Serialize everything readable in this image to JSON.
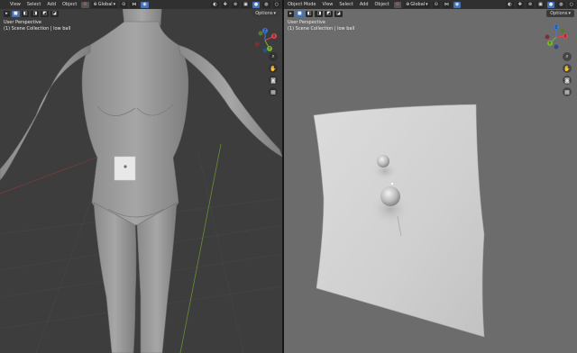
{
  "left_viewport": {
    "header": {
      "mode": "",
      "menus": [
        "View",
        "Select",
        "Add",
        "Object"
      ],
      "transform_orientation": "Global",
      "options_label": "Options"
    },
    "info": {
      "perspective": "User Perspective",
      "collection": "(1) Scene Collection | low ball"
    },
    "gizmo": {
      "x": "X",
      "y": "Y",
      "z": "Z"
    }
  },
  "right_viewport": {
    "header": {
      "mode": "Object Mode",
      "menus": [
        "View",
        "Select",
        "Add",
        "Object"
      ],
      "transform_orientation": "Global",
      "options_label": "Options"
    },
    "info": {
      "perspective": "User Perspective",
      "collection": "(1) Scene Collection | low ball"
    },
    "gizmo": {
      "x": "X",
      "y": "Y",
      "z": "Z"
    }
  },
  "colors": {
    "viewport_left_bg": "#3d3d3d",
    "viewport_right_bg": "#6c6c6c",
    "header_bg": "#303030",
    "selected_accent": "#4772b3",
    "axis_x": "#e0434c",
    "axis_y": "#7ab52a",
    "axis_z": "#3c78d8"
  },
  "icons": [
    "select-box-icon",
    "hand-pan-icon",
    "camera-icon",
    "grid-icon",
    "zoom-icon",
    "shading-solid-icon",
    "overlay-icon"
  ]
}
